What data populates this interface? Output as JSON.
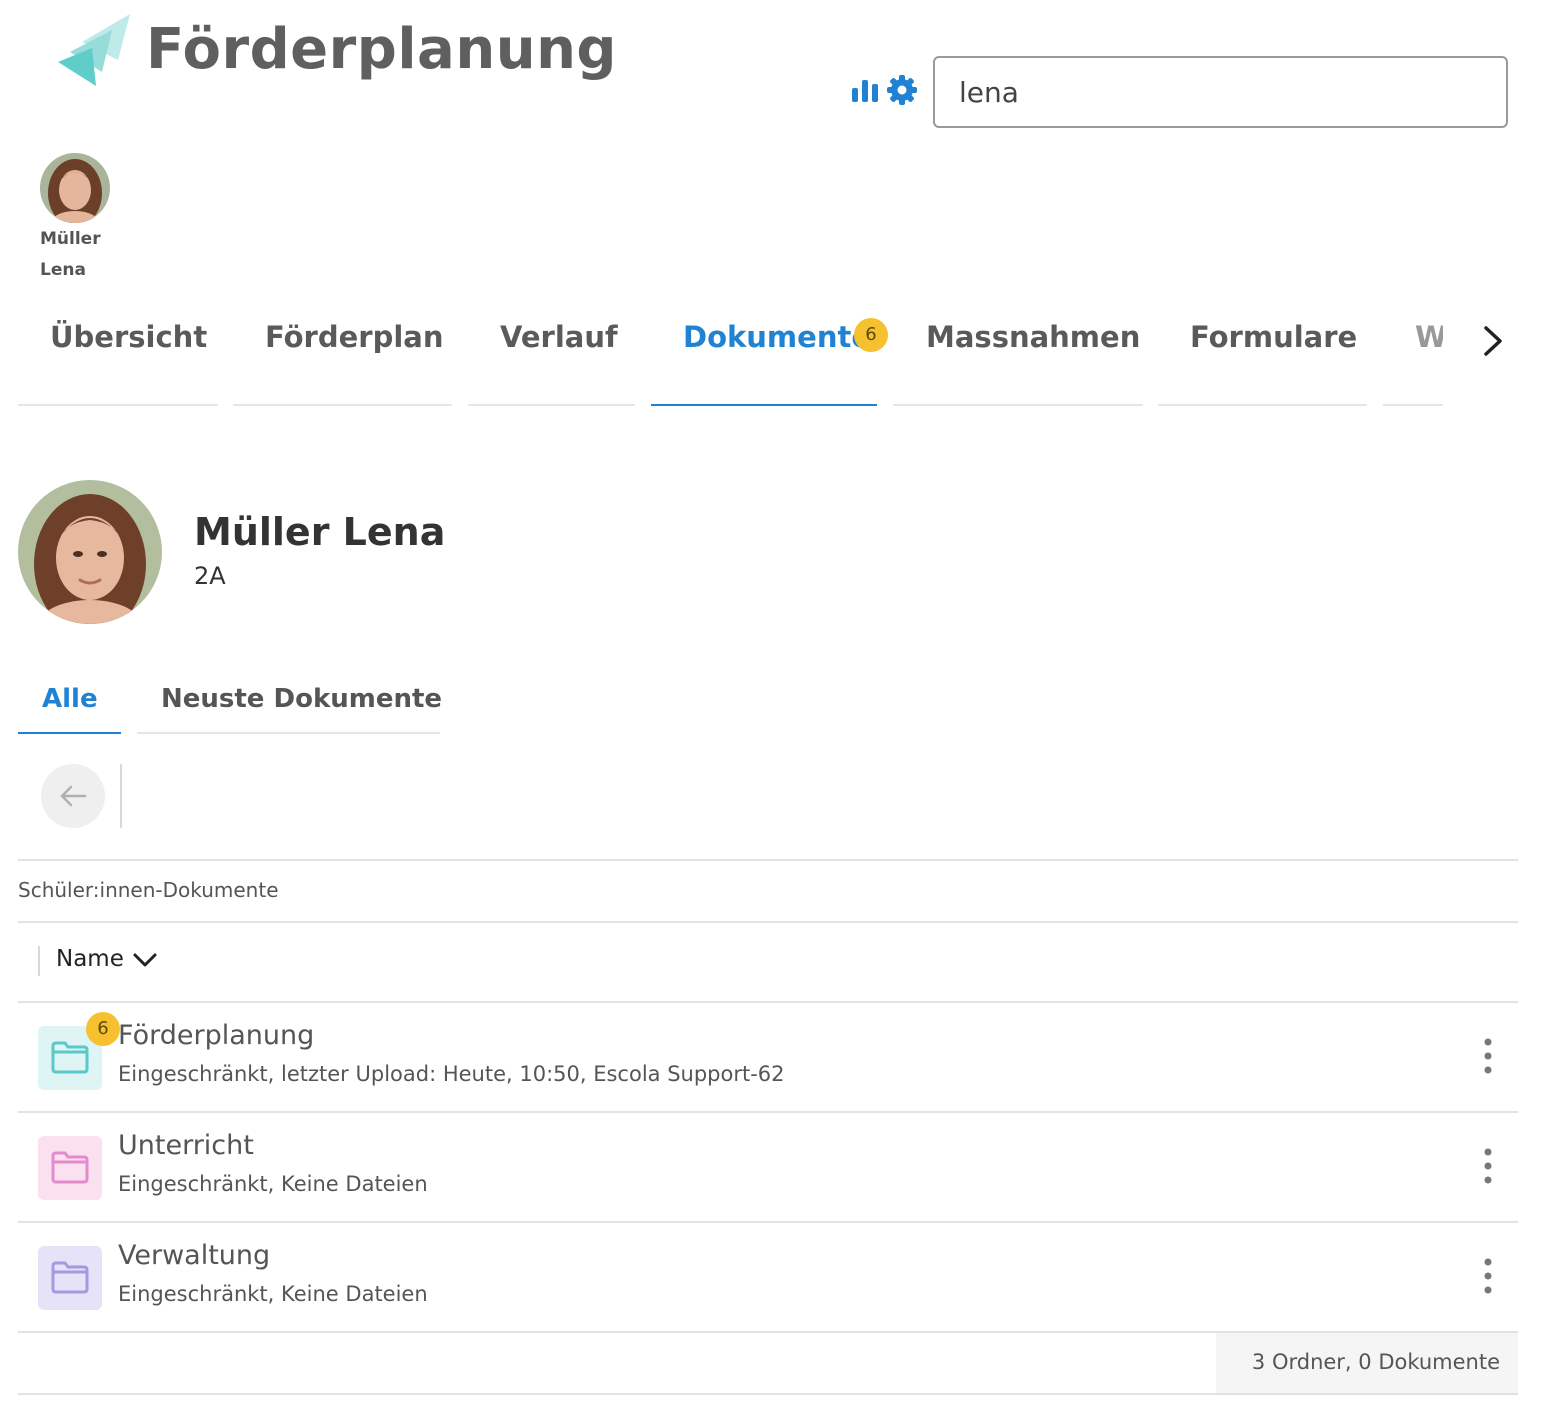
{
  "header": {
    "app_title": "Förderplanung",
    "search": {
      "value": "lena"
    }
  },
  "recent_student": {
    "last_name": "Müller",
    "first_name": "Lena"
  },
  "nav_tabs": [
    {
      "label": "Übersicht"
    },
    {
      "label": "Förderplan"
    },
    {
      "label": "Verlauf"
    },
    {
      "label": "Dokumente",
      "badge": "6",
      "active": true
    },
    {
      "label": "Massnahmen"
    },
    {
      "label": "Formulare"
    },
    {
      "label": "W"
    }
  ],
  "student": {
    "name": "Müller Lena",
    "class": "2A"
  },
  "sub_tabs": [
    {
      "label": "Alle",
      "active": true
    },
    {
      "label": "Neuste Dokumente"
    }
  ],
  "breadcrumb": "Schüler:innen-Dokumente",
  "sort": {
    "label": "Name"
  },
  "folders": [
    {
      "name": "Förderplanung",
      "details": "Eingeschränkt, letzter Upload: Heute, 10:50, Escola Support-62",
      "badge": "6",
      "color": "#59c9c9",
      "bg": "#dff4f4"
    },
    {
      "name": "Unterricht",
      "details": "Eingeschränkt, Keine Dateien",
      "color": "#e48ccb",
      "bg": "#fbe0ef"
    },
    {
      "name": "Verwaltung",
      "details": "Eingeschränkt, Keine Dateien",
      "color": "#a49ae0",
      "bg": "#e6e3f8"
    }
  ],
  "footer": {
    "count": "3 Ordner, 0 Dokumente"
  },
  "colors": {
    "accent": "#1f82d2",
    "badge": "#f6c02e",
    "logo": "#6dd2cc"
  }
}
